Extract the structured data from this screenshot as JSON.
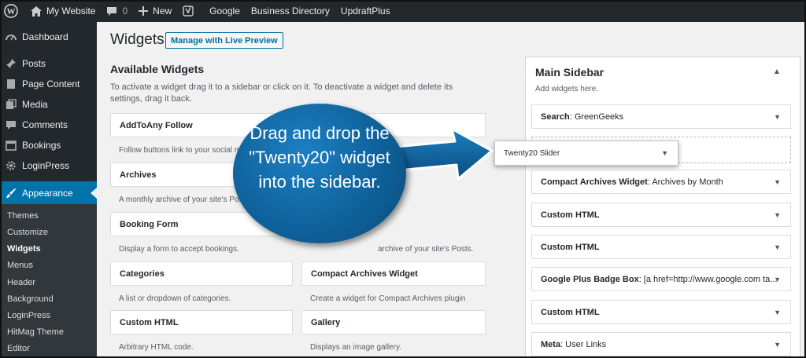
{
  "adminbar": {
    "site_name": "My Website",
    "comments_count": "0",
    "new_label": "New",
    "links": [
      "Google",
      "Business Directory",
      "UpdraftPlus"
    ]
  },
  "menu": {
    "items": [
      {
        "label": "Dashboard",
        "icon": "dashboard-icon"
      },
      {
        "label": "Posts",
        "icon": "pin-icon"
      },
      {
        "label": "Page Content",
        "icon": "page-icon"
      },
      {
        "label": "Media",
        "icon": "media-icon"
      },
      {
        "label": "Comments",
        "icon": "comment-icon"
      },
      {
        "label": "Bookings",
        "icon": "calendar-icon"
      },
      {
        "label": "LoginPress",
        "icon": "gear-icon"
      },
      {
        "label": "Appearance",
        "icon": "brush-icon"
      }
    ],
    "submenu": [
      "Themes",
      "Customize",
      "Widgets",
      "Menus",
      "Header",
      "Background",
      "LoginPress",
      "HitMag Theme",
      "Editor"
    ]
  },
  "page": {
    "title": "Widgets",
    "live_preview_button": "Manage with Live Preview",
    "available_title": "Available Widgets",
    "available_desc": "To activate a widget drag it to a sidebar or click on it. To deactivate a widget and delete its settings, drag it back."
  },
  "widgets": [
    {
      "title": "AddToAny Follow",
      "desc": "Follow buttons link to your social me"
    },
    {
      "title": "Archives",
      "desc": "A monthly archive of your site's Posts."
    },
    {
      "title": "Booking Form",
      "desc": "Display a form to accept bookings."
    },
    {
      "title": "Categories",
      "desc": "A list or dropdown of categories."
    },
    {
      "title": "Custom HTML",
      "desc": "Arbitrary HTML code."
    }
  ],
  "widgets_right": [
    {
      "title": "Compact Archives Widget",
      "desc": "Create a widget for Compact Archives plugin"
    },
    {
      "title": "Gallery",
      "desc": "Displays an image gallery."
    }
  ],
  "right_partial_desc": "archive of your site's Posts.",
  "main_sidebar": {
    "title": "Main Sidebar",
    "hint": "Add widgets here.",
    "widgets": [
      {
        "name": "Search",
        "detail": ": GreenGeeks"
      },
      {
        "name": "Compact Archives Widget",
        "detail": ": Archives by Month"
      },
      {
        "name": "Custom HTML",
        "detail": ""
      },
      {
        "name": "Custom HTML",
        "detail": ""
      },
      {
        "name": "Google Plus Badge Box",
        "detail": ": [a href=http://www.google.com ta..."
      },
      {
        "name": "Custom HTML",
        "detail": ""
      },
      {
        "name": "Meta",
        "detail": ": User Links"
      }
    ]
  },
  "dragging_widget": "Twenty20 Slider",
  "callout": "Drag and drop the \"Twenty20\" widget into the sidebar.",
  "colors": {
    "accent": "#0073aa",
    "callout": "#0e5f98",
    "adminbar": "#23282d"
  }
}
